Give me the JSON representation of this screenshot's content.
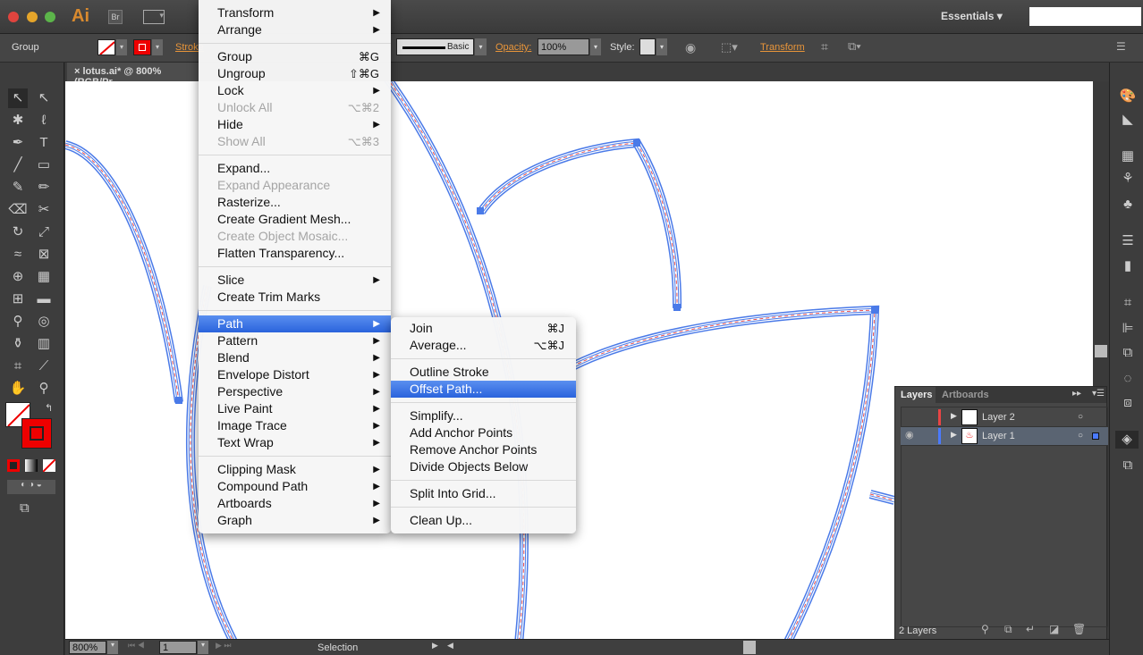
{
  "app": {
    "logo": "Ai",
    "bridge": "Br",
    "workspace": "Essentials",
    "search_placeholder": ""
  },
  "control_bar": {
    "selection_type": "Group",
    "stroke_label": "Stroke",
    "brush_label": "Basic",
    "opacity_label": "Opacity:",
    "opacity_value": "100%",
    "style_label": "Style:",
    "transform_label": "Transform"
  },
  "document": {
    "tab_title": "lotus.ai* @ 800% (RGB/Pr"
  },
  "object_menu": {
    "groups": [
      [
        {
          "label": "Transform",
          "submenu": true
        },
        {
          "label": "Arrange",
          "submenu": true
        }
      ],
      [
        {
          "label": "Group",
          "shortcut": "⌘G"
        },
        {
          "label": "Ungroup",
          "shortcut": "⇧⌘G"
        },
        {
          "label": "Lock",
          "submenu": true
        },
        {
          "label": "Unlock All",
          "shortcut": "⌥⌘2",
          "disabled": true
        },
        {
          "label": "Hide",
          "submenu": true
        },
        {
          "label": "Show All",
          "shortcut": "⌥⌘3",
          "disabled": true
        }
      ],
      [
        {
          "label": "Expand..."
        },
        {
          "label": "Expand Appearance",
          "disabled": true
        },
        {
          "label": "Rasterize..."
        },
        {
          "label": "Create Gradient Mesh..."
        },
        {
          "label": "Create Object Mosaic...",
          "disabled": true
        },
        {
          "label": "Flatten Transparency..."
        }
      ],
      [
        {
          "label": "Slice",
          "submenu": true
        },
        {
          "label": "Create Trim Marks"
        }
      ],
      [
        {
          "label": "Path",
          "submenu": true,
          "highlighted": true
        },
        {
          "label": "Pattern",
          "submenu": true
        },
        {
          "label": "Blend",
          "submenu": true
        },
        {
          "label": "Envelope Distort",
          "submenu": true
        },
        {
          "label": "Perspective",
          "submenu": true
        },
        {
          "label": "Live Paint",
          "submenu": true
        },
        {
          "label": "Image Trace",
          "submenu": true
        },
        {
          "label": "Text Wrap",
          "submenu": true
        }
      ],
      [
        {
          "label": "Clipping Mask",
          "submenu": true
        },
        {
          "label": "Compound Path",
          "submenu": true
        },
        {
          "label": "Artboards",
          "submenu": true
        },
        {
          "label": "Graph",
          "submenu": true
        }
      ]
    ]
  },
  "path_submenu": {
    "groups": [
      [
        {
          "label": "Join",
          "shortcut": "⌘J"
        },
        {
          "label": "Average...",
          "shortcut": "⌥⌘J"
        }
      ],
      [
        {
          "label": "Outline Stroke"
        },
        {
          "label": "Offset Path...",
          "highlighted": true
        }
      ],
      [
        {
          "label": "Simplify..."
        },
        {
          "label": "Add Anchor Points"
        },
        {
          "label": "Remove Anchor Points"
        },
        {
          "label": "Divide Objects Below"
        }
      ],
      [
        {
          "label": "Split Into Grid..."
        }
      ],
      [
        {
          "label": "Clean Up..."
        }
      ]
    ]
  },
  "layers_panel": {
    "tabs": [
      "Layers",
      "Artboards"
    ],
    "layers": [
      {
        "name": "Layer 2",
        "color": "#e84545",
        "visible": false,
        "selected": false
      },
      {
        "name": "Layer 1",
        "color": "#4a7aff",
        "visible": true,
        "selected": true
      }
    ],
    "count_label": "2 Layers"
  },
  "status_bar": {
    "zoom": "800%",
    "artboard": "1",
    "tool": "Selection"
  },
  "colors": {
    "path_blue": "#4a7ae8",
    "highlight": "#3a6fe0",
    "accent_orange": "#e8953a"
  }
}
